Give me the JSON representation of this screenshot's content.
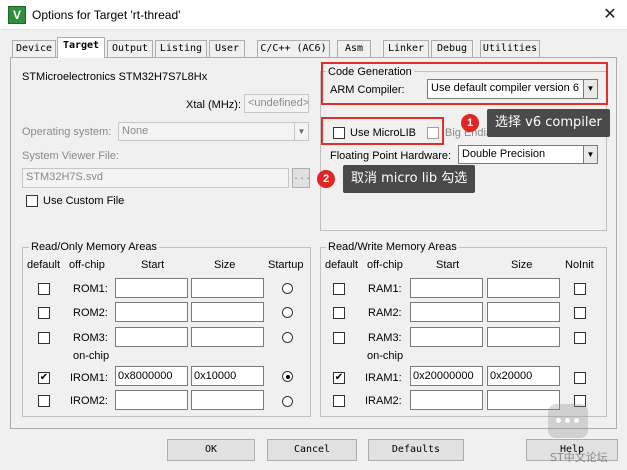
{
  "window": {
    "title": "Options for Target 'rt-thread'",
    "app_icon_glyph": "V",
    "close_glyph": "✕"
  },
  "tabs": [
    {
      "label": "Device"
    },
    {
      "label": "Target"
    },
    {
      "label": "Output"
    },
    {
      "label": "Listing"
    },
    {
      "label": "User"
    },
    {
      "label": "C/C++ (AC6)"
    },
    {
      "label": "Asm"
    },
    {
      "label": "Linker"
    },
    {
      "label": "Debug"
    },
    {
      "label": "Utilities"
    }
  ],
  "target": {
    "device_name": "STMicroelectronics STM32H7S7L8Hx",
    "xtal_label": "Xtal (MHz):",
    "xtal_value": "<undefined>",
    "os_label": "Operating system:",
    "os_value": "None",
    "svf_label": "System Viewer File:",
    "svf_value": "STM32H7S.svd",
    "browse_label": "...",
    "use_custom_file_label": "Use Custom File",
    "use_custom_file_checked": false
  },
  "codegen": {
    "group_title": "Code Generation",
    "arm_compiler_label": "ARM Compiler:",
    "arm_compiler_value": "Use default compiler version 6",
    "use_microlib_label": "Use MicroLIB",
    "use_microlib_checked": false,
    "big_endian_label": "Big Endian",
    "big_endian_checked": false,
    "fp_label": "Floating Point Hardware:",
    "fp_value": "Double Precision"
  },
  "annotations": [
    {
      "number": "1",
      "text": "选择 v6 compiler"
    },
    {
      "number": "2",
      "text": "取消 micro lib 勾选"
    }
  ],
  "rom_group": {
    "title": "Read/Only Memory Areas",
    "headers": {
      "default": "default",
      "offchip": "off-chip",
      "start": "Start",
      "size": "Size",
      "startup": "Startup"
    },
    "onchip_label": "on-chip",
    "rows": [
      {
        "name": "ROM1:",
        "default": false,
        "start": "",
        "size": "",
        "startup": false
      },
      {
        "name": "ROM2:",
        "default": false,
        "start": "",
        "size": "",
        "startup": false
      },
      {
        "name": "ROM3:",
        "default": false,
        "start": "",
        "size": "",
        "startup": false
      },
      {
        "name": "IROM1:",
        "default": true,
        "start": "0x8000000",
        "size": "0x10000",
        "startup": true
      },
      {
        "name": "IROM2:",
        "default": false,
        "start": "",
        "size": "",
        "startup": false
      }
    ]
  },
  "ram_group": {
    "title": "Read/Write Memory Areas",
    "headers": {
      "default": "default",
      "offchip": "off-chip",
      "start": "Start",
      "size": "Size",
      "noinit": "NoInit"
    },
    "onchip_label": "on-chip",
    "rows": [
      {
        "name": "RAM1:",
        "default": false,
        "start": "",
        "size": "",
        "noinit": false
      },
      {
        "name": "RAM2:",
        "default": false,
        "start": "",
        "size": "",
        "noinit": false
      },
      {
        "name": "RAM3:",
        "default": false,
        "start": "",
        "size": "",
        "noinit": false
      },
      {
        "name": "IRAM1:",
        "default": true,
        "start": "0x20000000",
        "size": "0x20000",
        "noinit": false
      },
      {
        "name": "IRAM2:",
        "default": false,
        "start": "",
        "size": "",
        "noinit": false
      }
    ]
  },
  "buttons": {
    "ok": "OK",
    "cancel": "Cancel",
    "defaults": "Defaults",
    "help": "Help"
  },
  "watermark": "ST中文论坛",
  "colors": {
    "annotation_red": "#e0302a",
    "tooltip_bg": "#4a4a4a"
  }
}
